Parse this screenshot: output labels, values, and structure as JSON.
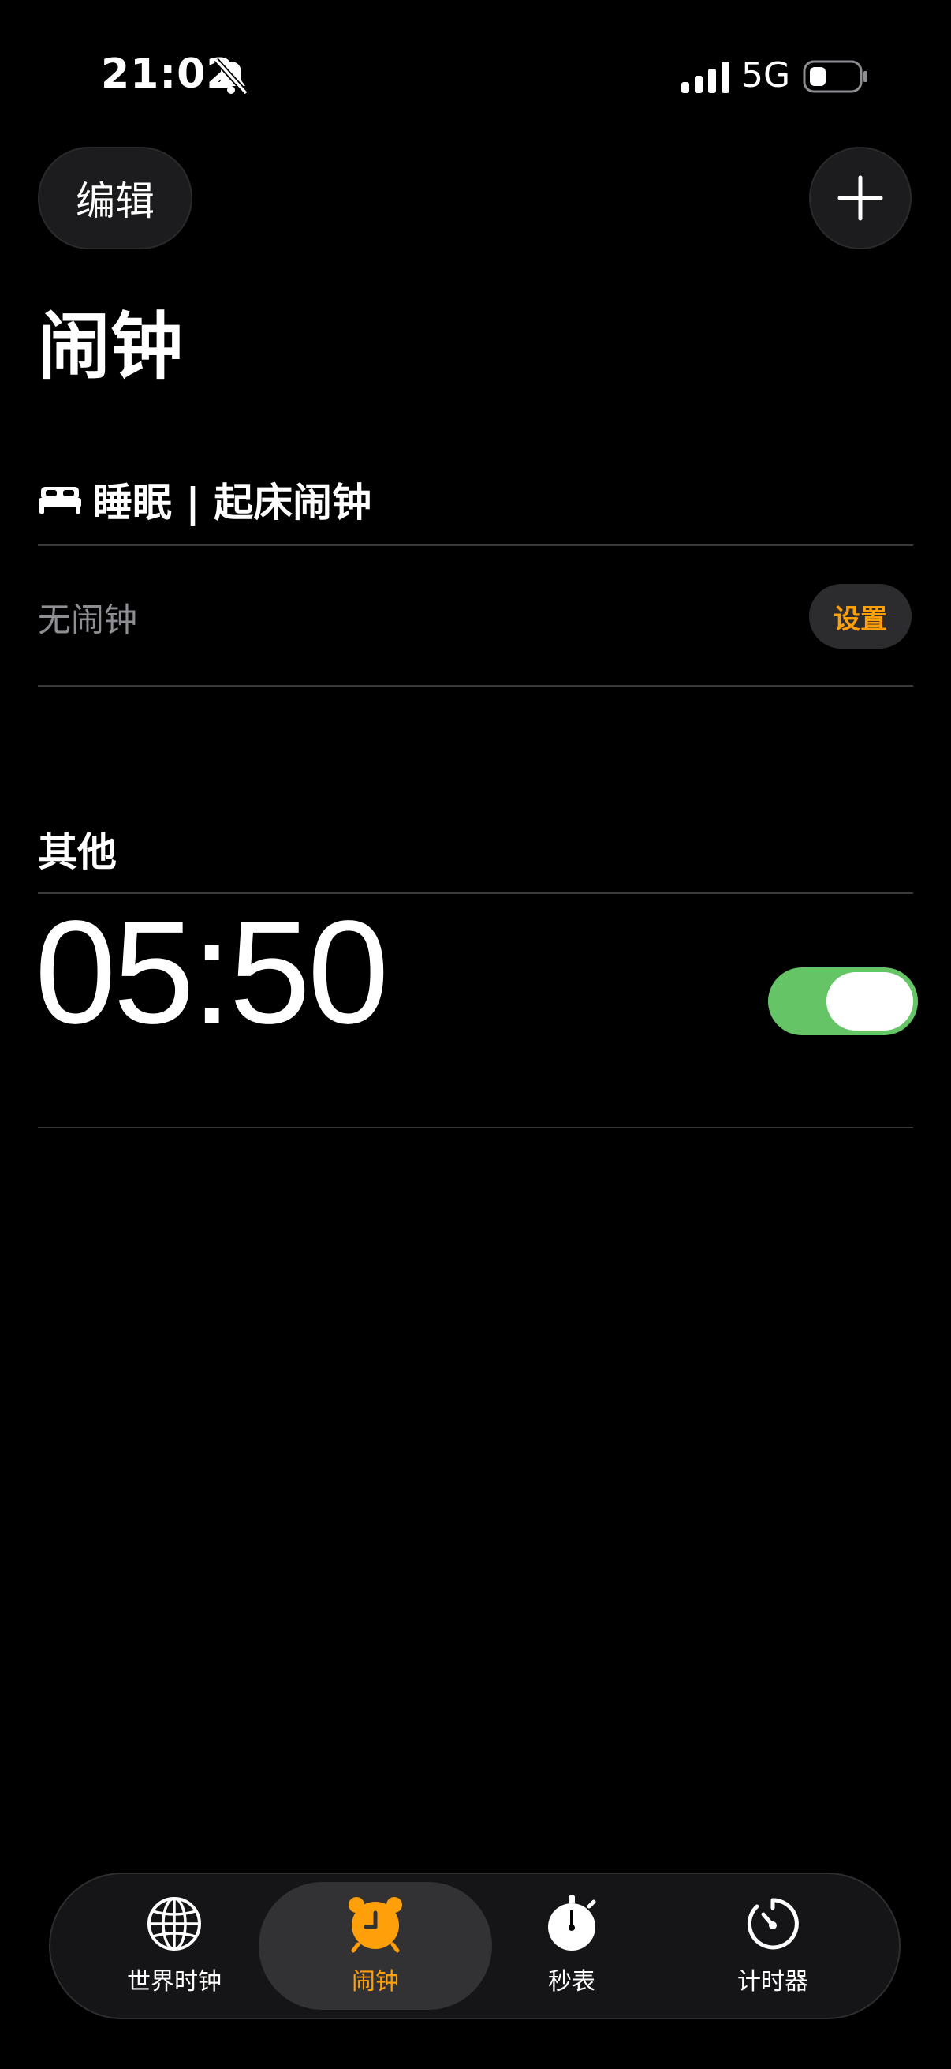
{
  "status_bar": {
    "time": "21:02",
    "network": "5G"
  },
  "header": {
    "edit_label": "编辑",
    "title": "闹钟"
  },
  "sleep_section": {
    "title": "睡眠 | 起床闹钟",
    "no_alarm": "无闹钟",
    "setup_label": "设置"
  },
  "other_section": {
    "title": "其他",
    "alarms": [
      {
        "time": "05:50",
        "enabled": true
      }
    ]
  },
  "tab_bar": {
    "tabs": [
      {
        "label": "世界时钟",
        "icon": "globe-icon",
        "active": false
      },
      {
        "label": "闹钟",
        "icon": "alarm-clock-icon",
        "active": true
      },
      {
        "label": "秒表",
        "icon": "stopwatch-icon",
        "active": false
      },
      {
        "label": "计时器",
        "icon": "timer-icon",
        "active": false
      }
    ]
  },
  "colors": {
    "accent": "#ff9f0a",
    "toggle_on": "#65c466",
    "background": "#000000"
  }
}
